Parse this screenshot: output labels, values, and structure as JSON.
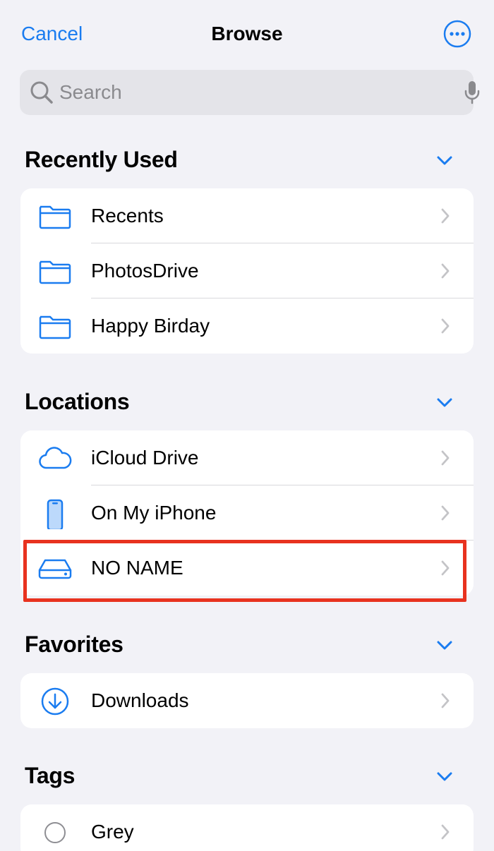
{
  "nav": {
    "cancel_label": "Cancel",
    "title": "Browse",
    "more_icon": "ellipsis-circle-icon"
  },
  "search": {
    "placeholder": "Search",
    "value": ""
  },
  "sections": [
    {
      "title": "Recently Used",
      "items": [
        {
          "label": "Recents",
          "icon": "folder-icon"
        },
        {
          "label": "PhotosDrive",
          "icon": "folder-icon"
        },
        {
          "label": "Happy Birday",
          "icon": "folder-icon"
        }
      ]
    },
    {
      "title": "Locations",
      "items": [
        {
          "label": "iCloud Drive",
          "icon": "cloud-icon"
        },
        {
          "label": "On My iPhone",
          "icon": "iphone-icon"
        },
        {
          "label": "NO NAME",
          "icon": "external-drive-icon",
          "highlighted": true
        }
      ]
    },
    {
      "title": "Favorites",
      "items": [
        {
          "label": "Downloads",
          "icon": "download-circle-icon"
        }
      ]
    },
    {
      "title": "Tags",
      "items": [
        {
          "label": "Grey",
          "icon": "grey-tag-icon"
        }
      ]
    }
  ],
  "colors": {
    "accent": "#1a7cf0",
    "background": "#f2f2f7",
    "card": "#ffffff",
    "highlight_border": "#e8321f",
    "chevron": "#c4c4c7"
  }
}
